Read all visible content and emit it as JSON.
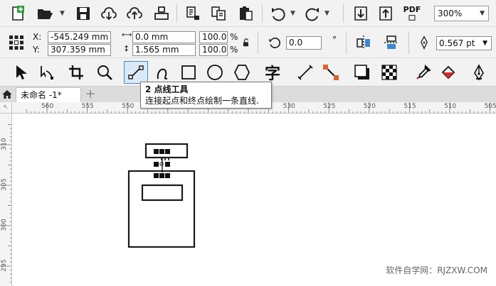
{
  "standard_toolbar": {
    "buttons": [
      "new-document",
      "open",
      "save",
      "import-cloud",
      "export-cloud",
      "print",
      "import",
      "export",
      "publish-pdf",
      "undo",
      "redo",
      "import-file",
      "export-file",
      "publish-to-pdf"
    ],
    "pdf_label": "PDF",
    "zoom_value": "300%"
  },
  "property_bar": {
    "x_label": "X:",
    "x_value": "-545.249 mm",
    "y_label": "Y:",
    "y_value": "307.359 mm",
    "width_value": "0.0 mm",
    "height_value": "1.565 mm",
    "scale_x": "100.0",
    "scale_y": "100.0",
    "percent": "%",
    "rotation_value": "0.0",
    "degree": "°",
    "outline_width": "0.567 pt"
  },
  "toolbox": {
    "selected": "2-point-line-tool",
    "text_tool_glyph": "字"
  },
  "tooltip": {
    "title": "2 点线工具",
    "description": "连接起点和终点绘制一条直线."
  },
  "document_tab": {
    "label": "未命名 -1*",
    "add": "+"
  },
  "rulers": {
    "horizontal": [
      "560",
      "555",
      "550",
      "545",
      "540",
      "535",
      "530",
      "525",
      "520",
      "515",
      "510",
      "505"
    ],
    "vertical": [
      "310",
      "305",
      "300",
      "295"
    ]
  },
  "watermark": "软件自学网：RJZXW.COM",
  "colors": {
    "accent": "#4a86c8",
    "toolbar_bg": "#f2f2f2",
    "canvas_bg": "#ffffff",
    "ink": "#1a1a1a"
  }
}
